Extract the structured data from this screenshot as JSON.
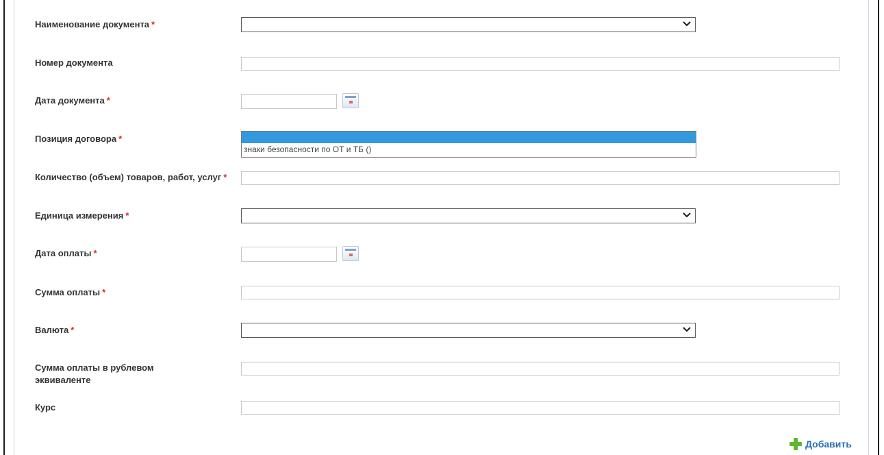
{
  "form": {
    "fields": {
      "doc_name": {
        "label": "Наименование документа",
        "required": "*"
      },
      "doc_number": {
        "label": "Номер документа",
        "value": ""
      },
      "doc_date": {
        "label": "Дата документа",
        "required": "*",
        "value": ""
      },
      "contract_position": {
        "label": "Позиция договора",
        "required": "*",
        "options": [
          "",
          "знаки безопасности по ОТ и ТБ ()"
        ]
      },
      "quantity": {
        "label": "Количество (объем) товаров, работ, услуг",
        "required": "*",
        "value": ""
      },
      "unit": {
        "label": "Единица измерения",
        "required": "*"
      },
      "payment_date": {
        "label": "Дата оплаты",
        "required": "*",
        "value": ""
      },
      "payment_amount": {
        "label": "Сумма оплаты",
        "required": "*",
        "value": ""
      },
      "currency": {
        "label": "Валюта",
        "required": "*"
      },
      "amount_rub": {
        "label": "Сумма оплаты в рублевом эквиваленте",
        "value": ""
      },
      "rate": {
        "label": "Курс",
        "value": ""
      }
    },
    "add_button": {
      "label": "Добавить",
      "icon": "plus-icon"
    }
  },
  "colors": {
    "required_marker": "#d62b2b",
    "link": "#2b6fb5",
    "listbox_selected": "#3399dd",
    "add_icon": "#5cb82f"
  }
}
